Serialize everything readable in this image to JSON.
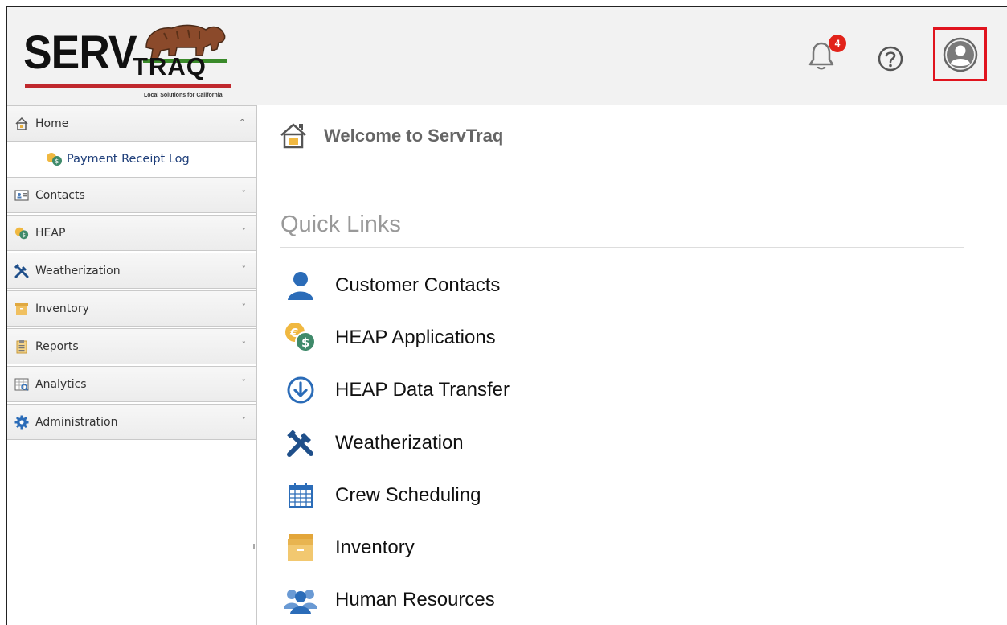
{
  "brand": {
    "logo_main": "SERV",
    "logo_sub": "TRAQ",
    "tagline": "Local Solutions for California"
  },
  "header": {
    "notification_count": "4",
    "icons": [
      "bell-icon",
      "help-icon",
      "user-icon"
    ]
  },
  "sidebar": {
    "items": [
      {
        "label": "Home",
        "icon": "home-icon",
        "chevron": "^"
      },
      {
        "label": "Contacts",
        "icon": "contact-card-icon",
        "chevron": "˅"
      },
      {
        "label": "HEAP",
        "icon": "coins-icon",
        "chevron": "˅"
      },
      {
        "label": "Weatherization",
        "icon": "tools-icon",
        "chevron": "˅"
      },
      {
        "label": "Inventory",
        "icon": "box-icon",
        "chevron": "˅"
      },
      {
        "label": "Reports",
        "icon": "clipboard-icon",
        "chevron": "˅"
      },
      {
        "label": "Analytics",
        "icon": "analytics-icon",
        "chevron": "˅"
      },
      {
        "label": "Administration",
        "icon": "gear-icon",
        "chevron": "˅"
      }
    ],
    "home_subitems": [
      {
        "label": "Payment Receipt Log",
        "icon": "coins-icon"
      }
    ]
  },
  "main": {
    "welcome": "Welcome to ServTraq",
    "quick_links_title": "Quick Links",
    "quick_links": [
      {
        "label": "Customer Contacts",
        "icon": "person-icon"
      },
      {
        "label": "HEAP Applications",
        "icon": "coins-icon"
      },
      {
        "label": "HEAP Data Transfer",
        "icon": "download-circle-icon"
      },
      {
        "label": "Weatherization",
        "icon": "tools-icon"
      },
      {
        "label": "Crew Scheduling",
        "icon": "calendar-icon"
      },
      {
        "label": "Inventory",
        "icon": "box-icon"
      },
      {
        "label": "Human Resources",
        "icon": "people-icon"
      }
    ]
  },
  "colors": {
    "header_bg": "#f2f2f2",
    "accent_red": "#e0141e",
    "link_blue": "#1f3f7a",
    "icon_blue": "#2b6cb8",
    "icon_gold": "#f0c060"
  }
}
